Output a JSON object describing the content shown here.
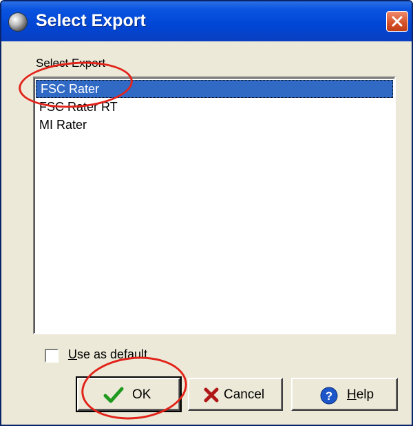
{
  "window": {
    "title": "Select Export"
  },
  "group": {
    "label": "Select Export"
  },
  "list": {
    "items": [
      {
        "label": "FSC Rater",
        "selected": true
      },
      {
        "label": "FSC Rater RT",
        "selected": false
      },
      {
        "label": "MI Rater",
        "selected": false
      }
    ]
  },
  "default_checkbox": {
    "label": "Use as default",
    "checked": false
  },
  "buttons": {
    "ok": "OK",
    "cancel": "Cancel",
    "help": "Help"
  },
  "icons": {
    "title": "app-orb-icon",
    "close": "close-icon",
    "ok": "checkmark-icon",
    "cancel": "x-icon",
    "help": "help-icon"
  },
  "colors": {
    "titlebar": "#0046d5",
    "selection": "#316ac5",
    "annotation": "#e2231a",
    "dialog_bg": "#ece9d8"
  }
}
